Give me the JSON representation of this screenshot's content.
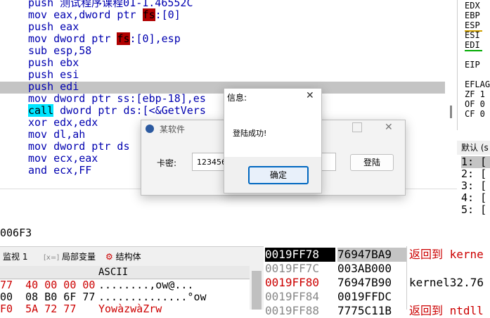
{
  "disasm": {
    "lines": [
      {
        "op": "push",
        "arg": "测试程序课程01-1.46552C"
      },
      {
        "op": "mov",
        "pre": "eax,dword ptr ",
        "seg": "fs",
        "post": ":[0]"
      },
      {
        "op": "push",
        "arg": "eax"
      },
      {
        "op": "mov",
        "pre": "dword ptr ",
        "seg": "fs",
        "post": ":[0],esp"
      },
      {
        "op": "sub",
        "arg": "esp,58"
      },
      {
        "op": "push",
        "arg": "ebx"
      },
      {
        "op": "push",
        "arg": "esi"
      },
      {
        "op": "push",
        "arg": "edi"
      },
      {
        "op": "mov",
        "arg": "dword ptr ss:[ebp-18],es"
      },
      {
        "op": "call",
        "arg": "dword ptr ds:[<&GetVers"
      },
      {
        "op": "xor",
        "arg": "edx,edx"
      },
      {
        "op": "mov",
        "arg": "dl,ah"
      },
      {
        "op": "mov",
        "arg": "dword ptr ds"
      },
      {
        "op": "mov",
        "arg": "ecx,eax"
      },
      {
        "op": "and",
        "arg": "ecx,FF"
      }
    ],
    "info_address": "006F3"
  },
  "registers": [
    "EDX",
    "EBP",
    "ESP",
    "ESI",
    "EDI",
    "",
    "EIP",
    "",
    "EFLAG",
    "ZF 1",
    "OF 0",
    "CF 0"
  ],
  "stack_header": "默认 (s",
  "stack_args": [
    "1: [",
    "2: [",
    "3: [",
    "4: [",
    "5: ["
  ],
  "tabs": [
    {
      "label": "监视 1"
    },
    {
      "label": "局部变量"
    },
    {
      "label": "结构体"
    }
  ],
  "dump": {
    "header": "ASCII",
    "rows": [
      {
        "hex": "77  40 00 00 00",
        "ascii": "........‚ow@..."
      },
      {
        "hex": "00  08 B0 6F 77",
        "ascii": "..............°ow"
      },
      {
        "hex": "F0  5A 72 77",
        "ascii": "YowàzwàZrw"
      }
    ]
  },
  "stack": [
    {
      "addr": "0019FF78",
      "val": "76947BA9",
      "comment": "返回到 kerne",
      "addr_style": "current",
      "comment_color": "#cc0000"
    },
    {
      "addr": "0019FF7C",
      "val": "003AB000",
      "comment": "",
      "addr_style": "gray",
      "comment_color": "#000"
    },
    {
      "addr": "0019FF80",
      "val": "76947B90",
      "comment": "kernel32.76",
      "addr_style": "red",
      "comment_color": "#000"
    },
    {
      "addr": "0019FF84",
      "val": "0019FFDC",
      "comment": "",
      "addr_style": "gray",
      "comment_color": "#000"
    },
    {
      "addr": "0019FF88",
      "val": "7775C11B",
      "comment": "返回到 ntdll",
      "addr_style": "gray",
      "comment_color": "#cc0000"
    }
  ],
  "app_dialog": {
    "title": "某软件",
    "label": "卡密:",
    "value": "123456",
    "login_button": "登陆"
  },
  "msg_dialog": {
    "title": "信息:",
    "message": "登陆成功!",
    "ok_button": "确定",
    "close_glyph": "✕"
  },
  "colors": {
    "accent": "#0067c0",
    "selected_row": "#c4c4c4"
  }
}
